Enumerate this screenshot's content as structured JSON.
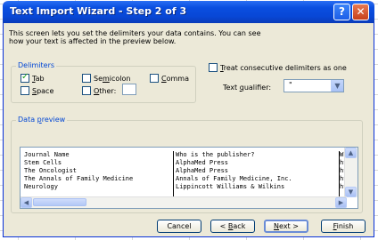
{
  "dialog": {
    "title": "Text Import Wizard - Step 2 of 3",
    "help_glyph": "?",
    "close_glyph": "✕"
  },
  "description": {
    "line1": "This screen lets you set the delimiters your data contains.  You can see",
    "line2": "how your text is affected in the preview below."
  },
  "delimiters": {
    "group_label": "Delimiters",
    "tab": {
      "label_pre": "",
      "label_key": "T",
      "label_post": "ab",
      "checked": true
    },
    "semicolon": {
      "label_pre": "Se",
      "label_key": "m",
      "label_post": "icolon",
      "checked": false
    },
    "comma": {
      "label_pre": "",
      "label_key": "C",
      "label_post": "omma",
      "checked": false
    },
    "space": {
      "label_pre": "",
      "label_key": "S",
      "label_post": "pace",
      "checked": false
    },
    "other": {
      "label_pre": "",
      "label_key": "O",
      "label_post": "ther:",
      "checked": false,
      "value": ""
    }
  },
  "consecutive": {
    "label_pre": "",
    "label_key": "T",
    "label_post": "reat consecutive delimiters as one",
    "checked": false
  },
  "text_qualifier": {
    "label_pre": "Text ",
    "label_key": "q",
    "label_post": "ualifier:",
    "value": "\"",
    "arrow_glyph": "▼"
  },
  "preview": {
    "group_label_pre": "Data ",
    "group_label_key": "p",
    "group_label_post": "review",
    "col1": [
      "Journal Name",
      "Stem Cells",
      "The Oncologist",
      "The Annals of Family Medicine",
      "Neurology"
    ],
    "col2": [
      "Who is the publisher?",
      "AlphaMed Press",
      "AlphaMed Press",
      "Annals of Family Medicine, Inc.",
      "Lippincott Williams & Wilkins"
    ],
    "col3": [
      "Whe",
      "htt",
      "htt",
      "htt",
      "htt"
    ],
    "scroll_up": "▲",
    "scroll_down": "▼",
    "scroll_left": "◀",
    "scroll_right": "▶"
  },
  "buttons": {
    "cancel": "Cancel",
    "back": {
      "pre": "< ",
      "key": "B",
      "post": "ack"
    },
    "next": {
      "pre": "",
      "key": "N",
      "post": "ext >"
    },
    "finish": {
      "pre": "",
      "key": "F",
      "post": "inish"
    }
  }
}
